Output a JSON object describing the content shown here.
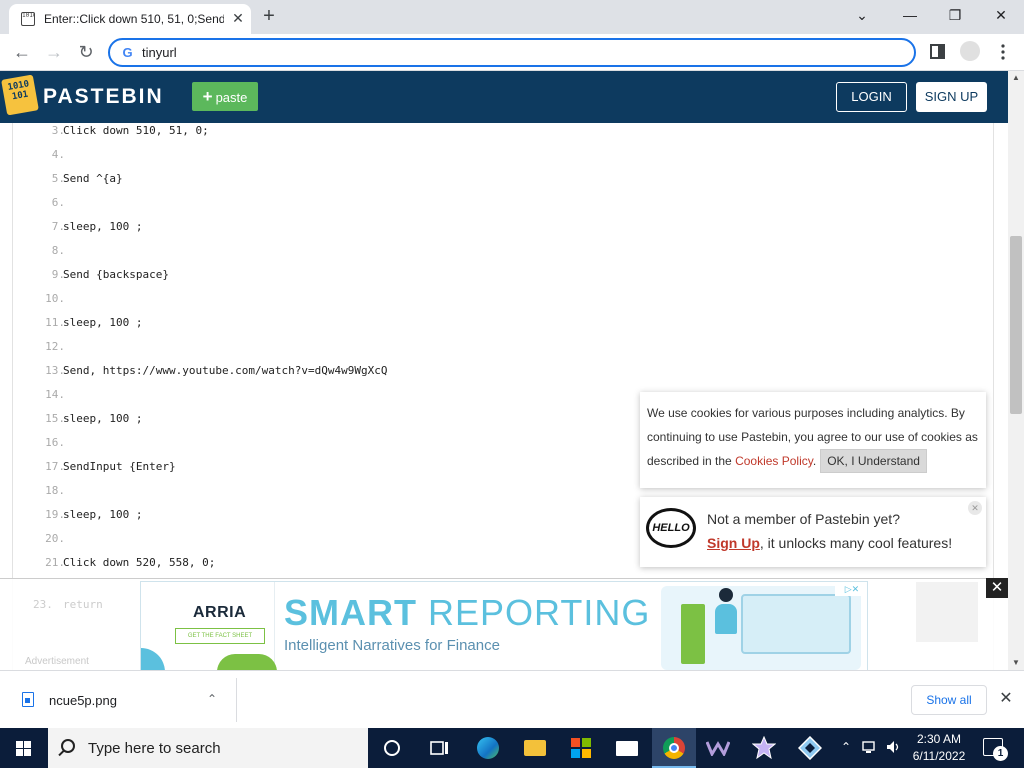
{
  "browser": {
    "tab_title": "Enter::Click down 510, 51, 0;Send",
    "favicon_text": "1010",
    "address": "tinyurl",
    "window_controls": [
      "⌄",
      "—",
      "❐",
      "✕"
    ]
  },
  "pastebin": {
    "brand": "PASTEBIN",
    "logo_text": "1010\n101",
    "paste_label": "paste",
    "login_label": "LOGIN",
    "signup_label": "SIGN UP"
  },
  "code": {
    "lines": [
      {
        "n": "3.",
        "text": "Click down 510, 51, 0;"
      },
      {
        "n": "4.",
        "text": ""
      },
      {
        "n": "5.",
        "text": "Send ^{a}"
      },
      {
        "n": "6.",
        "text": ""
      },
      {
        "n": "7.",
        "text": "sleep, 100 ;"
      },
      {
        "n": "8.",
        "text": ""
      },
      {
        "n": "9.",
        "text": "Send {backspace}"
      },
      {
        "n": "10.",
        "text": ""
      },
      {
        "n": "11.",
        "text": "sleep, 100 ;"
      },
      {
        "n": "12.",
        "text": ""
      },
      {
        "n": "13.",
        "text": "Send, https://www.youtube.com/watch?v=dQw4w9WgXcQ"
      },
      {
        "n": "14.",
        "text": ""
      },
      {
        "n": "15.",
        "text": "sleep, 100 ;"
      },
      {
        "n": "16.",
        "text": ""
      },
      {
        "n": "17.",
        "text": "SendInput {Enter}"
      },
      {
        "n": "18.",
        "text": ""
      },
      {
        "n": "19.",
        "text": "sleep, 100 ;"
      },
      {
        "n": "20.",
        "text": ""
      },
      {
        "n": "21.",
        "text": "Click down 520, 558, 0;"
      }
    ],
    "faded_line_number": "23.",
    "faded_line_text": "return"
  },
  "cookie": {
    "text_before": "We use cookies for various purposes including analytics. By continuing to use Pastebin, you agree to our use of cookies as described in the ",
    "link": "Cookies Policy",
    "text_after": ".",
    "button": "OK, I Understand"
  },
  "hello": {
    "icon_text": "HELLO",
    "line1": "Not a member of Pastebin yet?",
    "signup": "Sign Up",
    "line2_rest": ", it unlocks many cool features!"
  },
  "ad": {
    "label": "Advertisement",
    "brand": "ARRIA",
    "cta": "GET THE FACT SHEET",
    "headline_bold": "SMART",
    "headline_rest": " REPORTING",
    "tagline": "Intelligent Narratives for Finance",
    "adchoices": "▷✕"
  },
  "download": {
    "filename": "ncue5p.png",
    "show_all": "Show all"
  },
  "taskbar": {
    "search_placeholder": "Type here to search",
    "time": "2:30 AM",
    "date": "6/11/2022",
    "notification_count": "1"
  }
}
